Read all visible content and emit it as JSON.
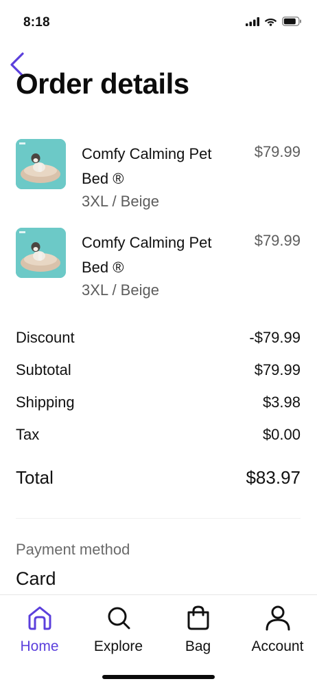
{
  "status_bar": {
    "time": "8:18"
  },
  "header": {
    "back_icon": "chevron-left-icon",
    "title": "Order details"
  },
  "items": [
    {
      "name": "Comfy Calming Pet Bed ®",
      "variant": "3XL / Beige",
      "price": "$79.99",
      "image": "pet-bed-thumbnail"
    },
    {
      "name": "Comfy Calming Pet Bed ®",
      "variant": "3XL / Beige",
      "price": "$79.99",
      "image": "pet-bed-thumbnail"
    }
  ],
  "summary": {
    "discount_label": "Discount",
    "discount_value": "-$79.99",
    "subtotal_label": "Subtotal",
    "subtotal_value": "$79.99",
    "shipping_label": "Shipping",
    "shipping_value": "$3.98",
    "tax_label": "Tax",
    "tax_value": "$0.00",
    "total_label": "Total",
    "total_value": "$83.97"
  },
  "payment": {
    "label": "Payment method",
    "value": "Card"
  },
  "tab_bar": {
    "tabs": [
      {
        "label": "Home",
        "icon": "home-icon",
        "active": true
      },
      {
        "label": "Explore",
        "icon": "search-icon",
        "active": false
      },
      {
        "label": "Bag",
        "icon": "bag-icon",
        "active": false
      },
      {
        "label": "Account",
        "icon": "user-icon",
        "active": false
      }
    ]
  },
  "colors": {
    "accent": "#5b3fdc",
    "text": "#111111",
    "muted": "#5d5d5d"
  }
}
